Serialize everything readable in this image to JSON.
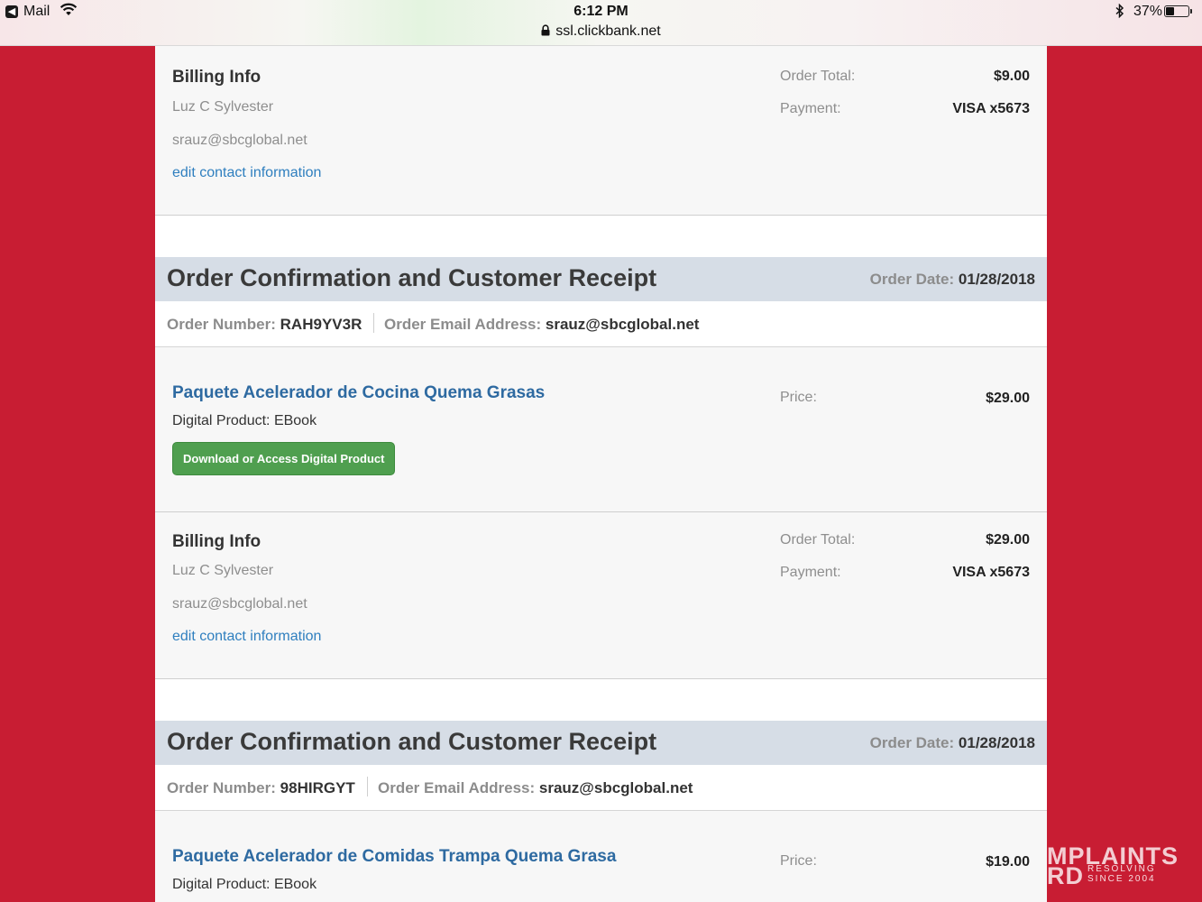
{
  "status_bar": {
    "back_app": "Mail",
    "time": "6:12 PM",
    "url": "ssl.clickbank.net",
    "battery_pct": "37%",
    "battery_level": 0.37
  },
  "billing_1": {
    "title": "Billing Info",
    "name": "Luz C Sylvester",
    "email": "srauz@sbcglobal.net",
    "edit_link": "edit contact information",
    "order_total_label": "Order Total:",
    "order_total": "$9.00",
    "payment_label": "Payment:",
    "payment": "VISA x5673"
  },
  "receipt_1": {
    "title": "Order Confirmation and Customer Receipt",
    "order_date_label": "Order Date:",
    "order_date": "01/28/2018",
    "order_number_label": "Order Number:",
    "order_number": "RAH9YV3R",
    "order_email_label": "Order Email Address:",
    "order_email": "srauz@sbcglobal.net",
    "product_title": "Paquete Acelerador de Cocina Quema Grasas",
    "product_type": "Digital Product: EBook",
    "download_button": "Download or Access Digital Product",
    "price_label": "Price:",
    "price": "$29.00"
  },
  "billing_2": {
    "title": "Billing Info",
    "name": "Luz C Sylvester",
    "email": "srauz@sbcglobal.net",
    "edit_link": "edit contact information",
    "order_total_label": "Order Total:",
    "order_total": "$29.00",
    "payment_label": "Payment:",
    "payment": "VISA x5673"
  },
  "receipt_2": {
    "title": "Order Confirmation and Customer Receipt",
    "order_date_label": "Order Date:",
    "order_date": "01/28/2018",
    "order_number_label": "Order Number:",
    "order_number": "98HIRGYT",
    "order_email_label": "Order Email Address:",
    "order_email": "srauz@sbcglobal.net",
    "product_title": "Paquete Acelerador de Comidas Trampa Quema Grasa",
    "product_type": "Digital Product: EBook",
    "price_label": "Price:",
    "price": "$19.00"
  },
  "watermark": {
    "line1": "MPLAINTS",
    "line2": "RD",
    "sub1": "RESOLVING",
    "sub2": "SINCE 2004"
  }
}
